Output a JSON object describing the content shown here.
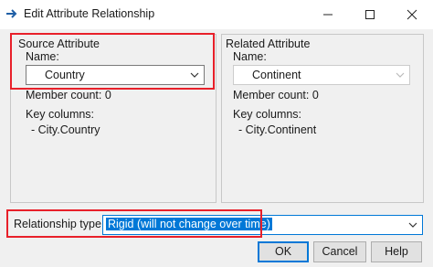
{
  "window": {
    "title": "Edit Attribute Relationship",
    "icon": "arrow-right-icon",
    "controls": [
      "minimize-icon",
      "maximize-icon",
      "close-icon"
    ]
  },
  "source": {
    "group_label": "Source Attribute",
    "name_label": "Name:",
    "name_value": "Country",
    "member_count": "Member count: 0",
    "key_columns_label": "Key columns:",
    "key_column": "- City.Country"
  },
  "related": {
    "group_label": "Related Attribute",
    "name_label": "Name:",
    "name_value": "Continent",
    "member_count": "Member count: 0",
    "key_columns_label": "Key columns:",
    "key_column": "- City.Continent"
  },
  "relationship": {
    "label": "Relationship type:",
    "value": "Rigid (will not change over time)"
  },
  "buttons": {
    "ok": "OK",
    "cancel": "Cancel",
    "help": "Help"
  },
  "colors": {
    "highlight": "#e8202a",
    "focus": "#0078d7"
  }
}
